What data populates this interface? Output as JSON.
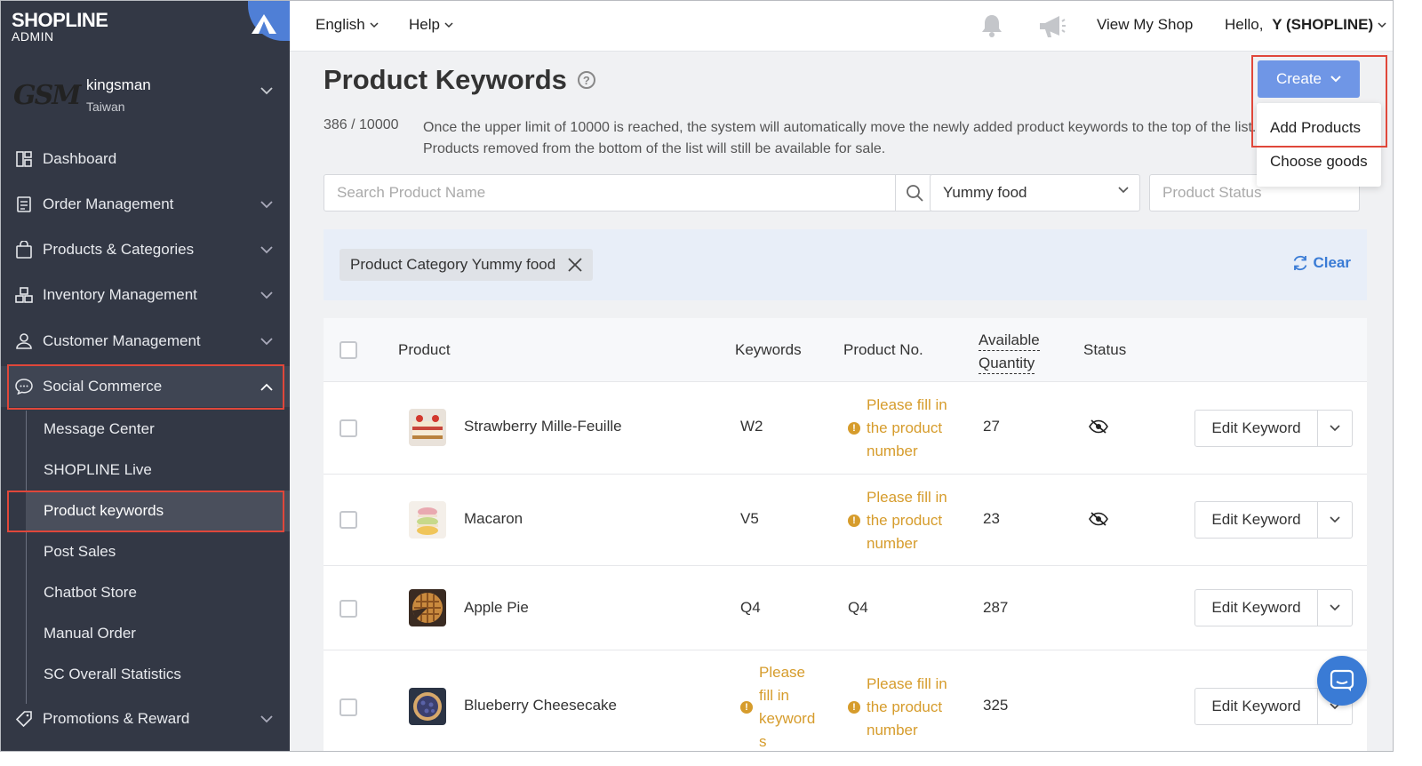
{
  "brand": {
    "name": "SHOPLINE",
    "sub": "ADMIN"
  },
  "shop": {
    "logo_text": "GSM",
    "name": "kingsman",
    "region": "Taiwan"
  },
  "sidebar": {
    "items": [
      {
        "label": "Dashboard",
        "icon": "dashboard-icon"
      },
      {
        "label": "Order Management",
        "icon": "order-icon"
      },
      {
        "label": "Products & Categories",
        "icon": "bag-icon"
      },
      {
        "label": "Inventory Management",
        "icon": "inventory-icon"
      },
      {
        "label": "Customer Management",
        "icon": "user-icon"
      },
      {
        "label": "Social Commerce",
        "icon": "chat-icon"
      },
      {
        "label": "Promotions & Reward",
        "icon": "tag-icon"
      }
    ],
    "social_sub": [
      "Message Center",
      "SHOPLINE Live",
      "Product keywords",
      "Post Sales",
      "Chatbot Store",
      "Manual Order",
      "SC Overall Statistics"
    ]
  },
  "topbar": {
    "language": "English",
    "help": "Help",
    "view_shop": "View My Shop",
    "greeting_prefix": "Hello, ",
    "greeting_user": "Y (SHOPLINE)"
  },
  "page": {
    "title": "Product Keywords",
    "limit_count": "386 / 10000",
    "limit_text": "Once the upper limit of 10000 is reached, the system will automatically move the newly added product keywords to the top of the list. Products removed from the bottom of the list will still be available for sale."
  },
  "filters": {
    "search_placeholder": "Search Product Name",
    "category_value": "Yummy food",
    "status_placeholder": "Product Status",
    "active_tag": "Product Category Yummy food",
    "clear_label": "Clear"
  },
  "create": {
    "label": "Create",
    "menu": [
      "Add Products",
      "Choose goods"
    ]
  },
  "table": {
    "headers": {
      "product": "Product",
      "keywords": "Keywords",
      "product_no": "Product No.",
      "qty_line1": "Available",
      "qty_line2": "Quantity",
      "status": "Status"
    },
    "action_label": "Edit Keyword",
    "rows": [
      {
        "name": "Strawberry Mille-Feuille",
        "keyword": "W2",
        "product_no": "",
        "no_warning": [
          "Please fill in",
          "the product",
          "number"
        ],
        "quantity": "27",
        "hidden": true
      },
      {
        "name": "Macaron",
        "keyword": "V5",
        "product_no": "",
        "no_warning": [
          "Please fill in",
          "the product",
          "number"
        ],
        "quantity": "23",
        "hidden": true
      },
      {
        "name": "Apple Pie",
        "keyword": "Q4",
        "product_no": "Q4",
        "quantity": "287",
        "hidden": false
      },
      {
        "name": "Blueberry Cheesecake",
        "keyword": "",
        "keyword_warning": [
          "Please",
          "fill in",
          "keyword",
          "s"
        ],
        "product_no": "",
        "no_warning": [
          "Please fill in",
          "the product",
          "number"
        ],
        "quantity": "325",
        "hidden": false
      }
    ]
  },
  "colors": {
    "sidebar": "#333845",
    "accent": "#3a7bd5",
    "warning": "#d69c2c",
    "highlight_box": "#e0473a"
  }
}
